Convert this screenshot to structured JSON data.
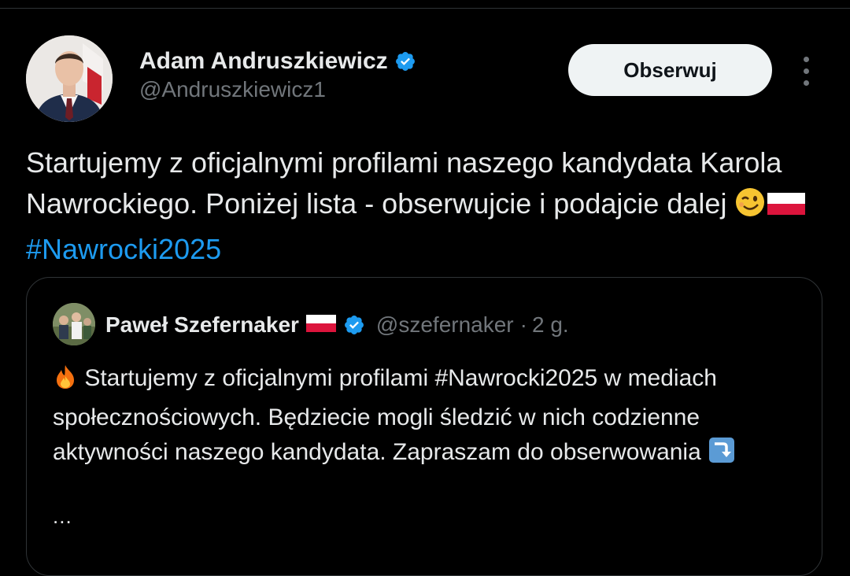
{
  "tweet": {
    "author": {
      "name": "Adam Andruszkiewicz",
      "handle": "@Andruszkiewicz1",
      "verified_icon": "verified-badge-icon"
    },
    "follow_label": "Obserwuj",
    "text_part1": "Startujemy z oficjalnymi profilami naszego kandydata Karola Nawrockiego. Poniżej lista - obserwujcie i podajcie dalej ",
    "hashtag": "#Nawrocki2025"
  },
  "quote": {
    "name": "Paweł Szefernaker",
    "handle": "@szefernaker",
    "separator": "·",
    "time": "2 g.",
    "text_part1": " Startujemy z oficjalnymi profilami #Nawrocki2025 w mediach społecznościowych. Będziecie mogli śledzić w nich codzienne aktywności naszego kandydata. Zapraszam do obserwowania ",
    "ellipsis": "..."
  },
  "colors": {
    "background": "#000000",
    "text": "#e7e9ea",
    "secondary": "#71767b",
    "link": "#1d9bf0",
    "border": "#2f3336",
    "button_bg": "#eff3f4"
  },
  "icons": [
    "wink-emoji-icon",
    "poland-flag-icon",
    "fire-emoji-icon",
    "arrow-down-emoji-icon",
    "more-options-icon"
  ]
}
